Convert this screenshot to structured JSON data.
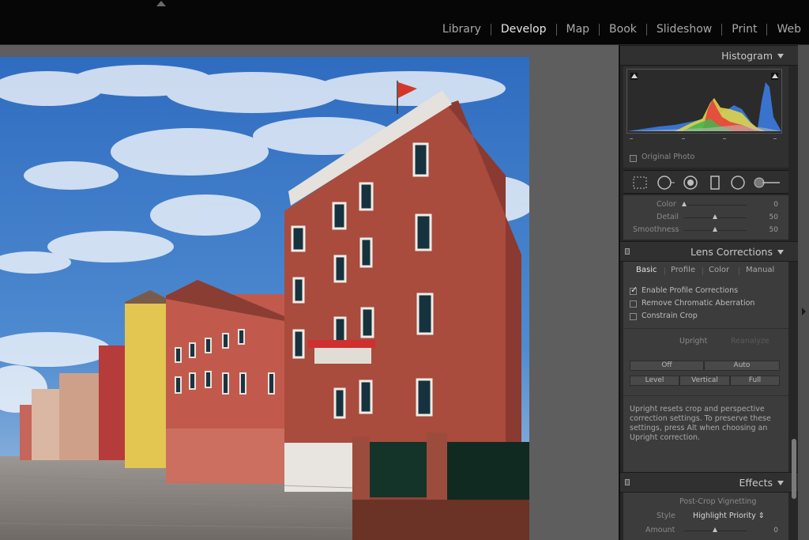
{
  "modules": [
    "Library",
    "Develop",
    "Map",
    "Book",
    "Slideshow",
    "Print",
    "Web"
  ],
  "active_module": "Develop",
  "histogram": {
    "title": "Histogram",
    "original_photo_label": "Original Photo"
  },
  "detail": {
    "rows": [
      {
        "label": "Color",
        "value": "0",
        "level": 0.0
      },
      {
        "label": "Detail",
        "value": "50",
        "level": 0.5
      },
      {
        "label": "Smoothness",
        "value": "50",
        "level": 0.5
      }
    ]
  },
  "lens": {
    "title": "Lens Corrections",
    "tabs": [
      "Basic",
      "Profile",
      "Color",
      "Manual"
    ],
    "active_tab": "Basic",
    "options": [
      {
        "label": "Enable Profile Corrections",
        "checked": true
      },
      {
        "label": "Remove Chromatic Aberration",
        "checked": false
      },
      {
        "label": "Constrain Crop",
        "checked": false
      }
    ],
    "upright_label": "Upright",
    "reanalyze_label": "Reanalyze",
    "upright_buttons": [
      "Off",
      "Auto",
      "Level",
      "Vertical",
      "Full"
    ],
    "note": "Upright resets crop and perspective correction settings. To preserve these settings, press Alt when choosing an Upright correction."
  },
  "effects": {
    "title": "Effects",
    "section": "Post-Crop Vignetting",
    "style_label": "Style",
    "style_value": "Highlight Priority",
    "amount_label": "Amount",
    "amount_value": "0",
    "amount_level": 0.5
  },
  "colors": {
    "accent_text": "#e6e6e6",
    "panel_bg": "#3c3c3c",
    "sky": "#3f7bc4",
    "building": "#a5473a"
  }
}
